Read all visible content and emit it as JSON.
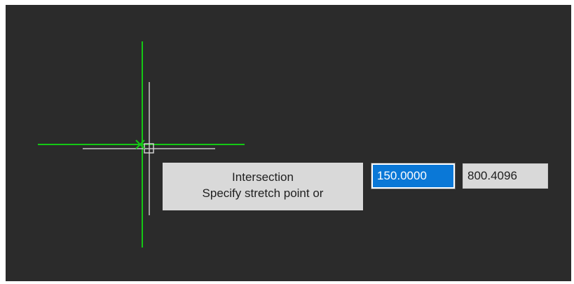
{
  "canvas": {
    "background_color": "#2b2b2b",
    "crosshair_color": "#14c814",
    "cursor_color": "#c8c8c8"
  },
  "osnap_tooltip": {
    "snap_label": "Intersection",
    "prompt": "Specify stretch point or"
  },
  "dynamic_input": {
    "x_value": "150.0000",
    "y_value": "800.4096",
    "active_color": "#0a78d7"
  }
}
